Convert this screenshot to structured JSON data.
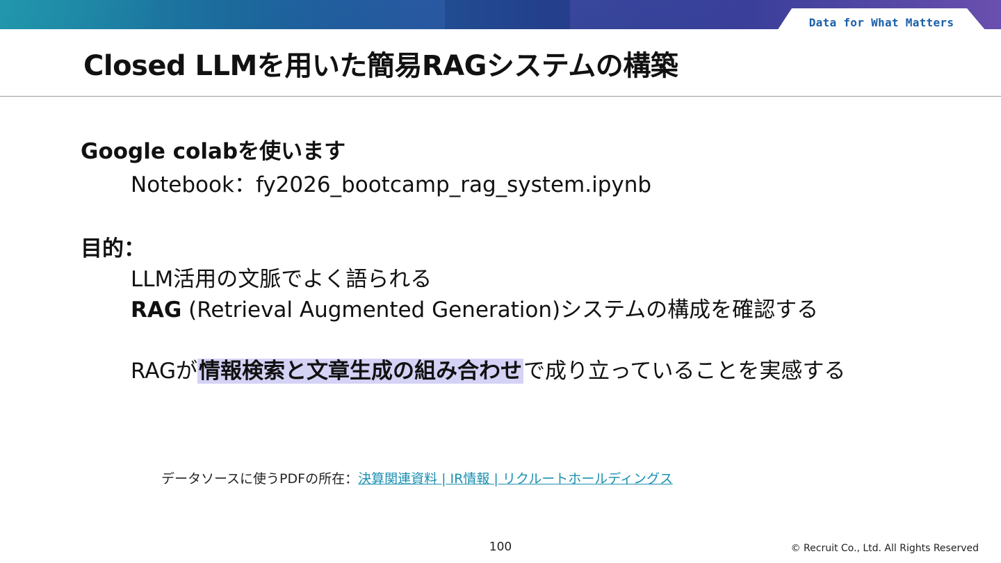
{
  "header": {
    "tagline": "Data for What Matters",
    "title": "Closed LLMを用いた簡易RAGシステムの構築"
  },
  "colab": {
    "heading": "Google colabを使います",
    "notebook_line": "Notebook：fy2026_bootcamp_rag_system.ipynb"
  },
  "purpose": {
    "heading": "目的：",
    "line1": "LLM活用の文脈でよく語られる",
    "line2_bold": "RAG",
    "line2_rest": " (Retrieval Augmented Generation)システムの構成を確認する",
    "line3_pre": "RAGが",
    "line3_highlight": "情報検索と文章生成の組み合わせ",
    "line3_post": "で成り立っていることを実感する"
  },
  "source": {
    "label": "データソースに使うPDFの所在：",
    "link_text": "決算関連資料 | IR情報 | リクルートホールディングス"
  },
  "footer": {
    "page_number": "100",
    "copyright": "© Recruit Co., Ltd. All Rights Reserved"
  },
  "colors": {
    "highlight": "#d4d2f5",
    "link": "#1a8fb0",
    "banner_start": "#1d8fa6",
    "banner_end": "#6a4fae"
  }
}
